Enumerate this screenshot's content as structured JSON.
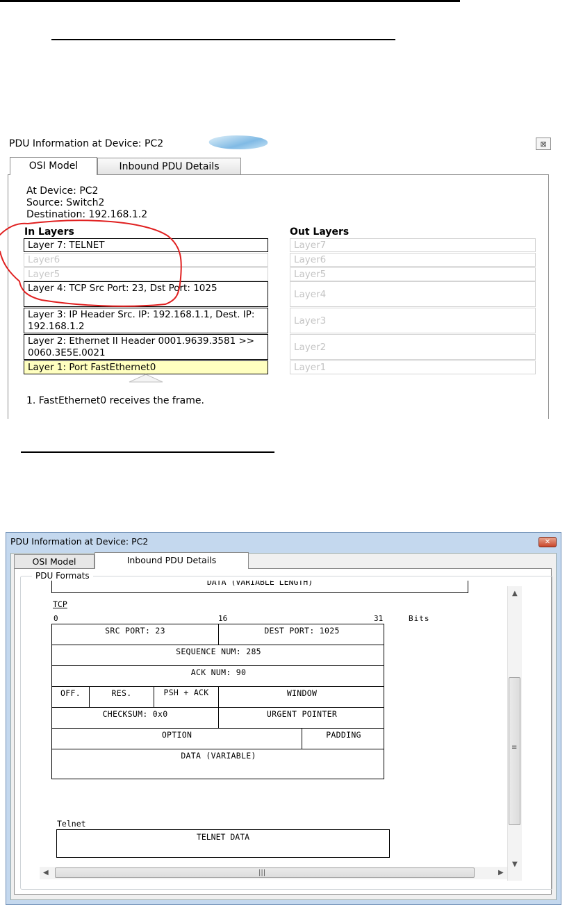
{
  "window1": {
    "title": "PDU Information at Device: PC2",
    "close_icon": "close-icon",
    "tabs": [
      {
        "label": "OSI Model",
        "active": true
      },
      {
        "label": "Inbound PDU Details",
        "active": false
      }
    ],
    "info": {
      "device": "At Device: PC2",
      "source": "Source: Switch2",
      "destination": "Destination: 192.168.1.2"
    },
    "in_layers_heading": "In Layers",
    "out_layers_heading": "Out Layers",
    "in_layers": [
      {
        "label": "Layer 7: TELNET",
        "state": "active"
      },
      {
        "label": "Layer6",
        "state": "faded"
      },
      {
        "label": "Layer5",
        "state": "faded"
      },
      {
        "label": "Layer 4: TCP Src Port: 23, Dst Port: 1025",
        "state": "active"
      },
      {
        "label": "Layer 3: IP Header Src. IP: 192.168.1.1, Dest. IP: 192.168.1.2",
        "state": "active"
      },
      {
        "label": "Layer 2: Ethernet II Header 0001.9639.3581 >> 0060.3E5E.0021",
        "state": "active"
      },
      {
        "label": "Layer 1: Port FastEthernet0",
        "state": "highlight"
      }
    ],
    "out_layers": [
      "Layer7",
      "Layer6",
      "Layer5",
      "Layer4",
      "Layer3",
      "Layer2",
      "Layer1"
    ],
    "step": "1. FastEthernet0 receives the frame.",
    "annotation_color": "#e02020",
    "highlight_color": "#ffffc0"
  },
  "window2": {
    "title": "PDU Information at Device: PC2",
    "close_icon": "close-icon",
    "tabs": [
      {
        "label": "OSI Model",
        "active": false
      },
      {
        "label": "Inbound PDU Details",
        "active": true
      }
    ],
    "group_label": "PDU Formats",
    "prev_block_text": "DATA (VARIABLE LENGTH)",
    "tcp_label": "TCP",
    "bit_scale": {
      "start": "0",
      "mid": "16",
      "end": "31",
      "unit": "Bits"
    },
    "tcp_rows": {
      "row1": {
        "src_port": "SRC PORT: 23",
        "dest_port": "DEST PORT: 1025"
      },
      "row2": {
        "sequence": "SEQUENCE NUM: 285"
      },
      "row3": {
        "ack": "ACK NUM: 90"
      },
      "row4": {
        "off": "OFF.",
        "res": "RES.",
        "flags": "PSH + ACK",
        "window": "WINDOW"
      },
      "row5": {
        "checksum": "CHECKSUM: 0x0",
        "urgent": "URGENT POINTER"
      },
      "row6": {
        "option": "OPTION",
        "padding": "PADDING"
      },
      "row7": {
        "data": "DATA (VARIABLE)"
      }
    },
    "telnet_label": "Telnet",
    "telnet_data": "TELNET DATA",
    "titlebar_color": "#c4d8ee"
  }
}
